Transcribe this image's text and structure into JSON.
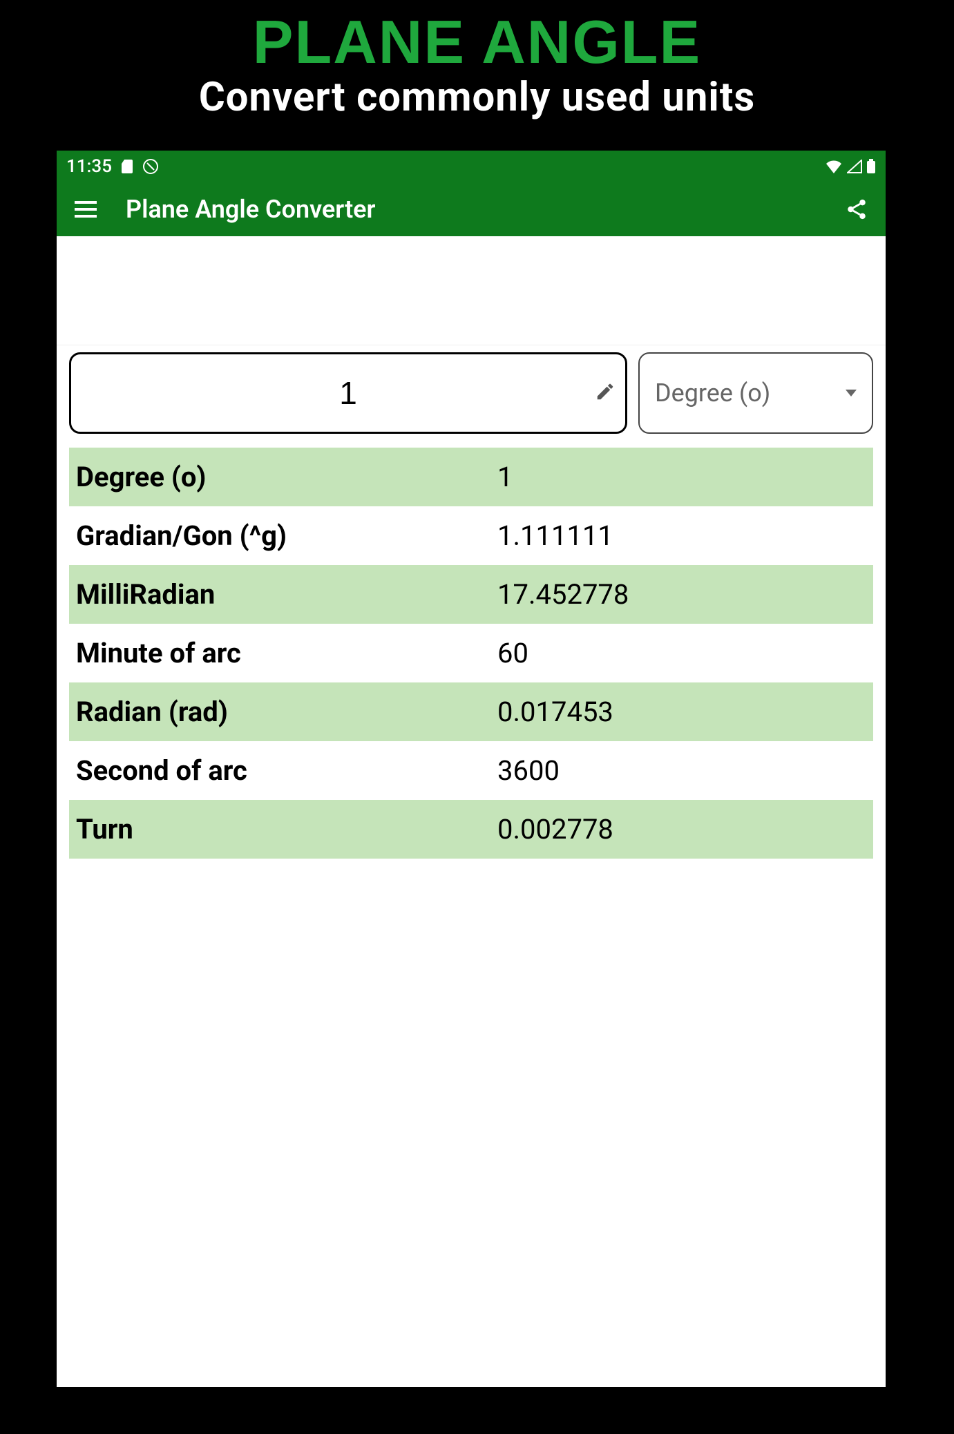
{
  "promo": {
    "title": "PLANE ANGLE",
    "subtitle": "Convert commonly used units"
  },
  "statusbar": {
    "time": "11:35"
  },
  "appbar": {
    "title": "Plane Angle Converter"
  },
  "input": {
    "value": "1",
    "unit_selected": "Degree (o)"
  },
  "results": [
    {
      "label": "Degree (o)",
      "value": "1"
    },
    {
      "label": "Gradian/Gon (^g)",
      "value": "1.111111"
    },
    {
      "label": "MilliRadian",
      "value": "17.452778"
    },
    {
      "label": "Minute of arc",
      "value": "60"
    },
    {
      "label": "Radian (rad)",
      "value": "0.017453"
    },
    {
      "label": "Second of arc",
      "value": "3600"
    },
    {
      "label": "Turn",
      "value": "0.002778"
    }
  ]
}
